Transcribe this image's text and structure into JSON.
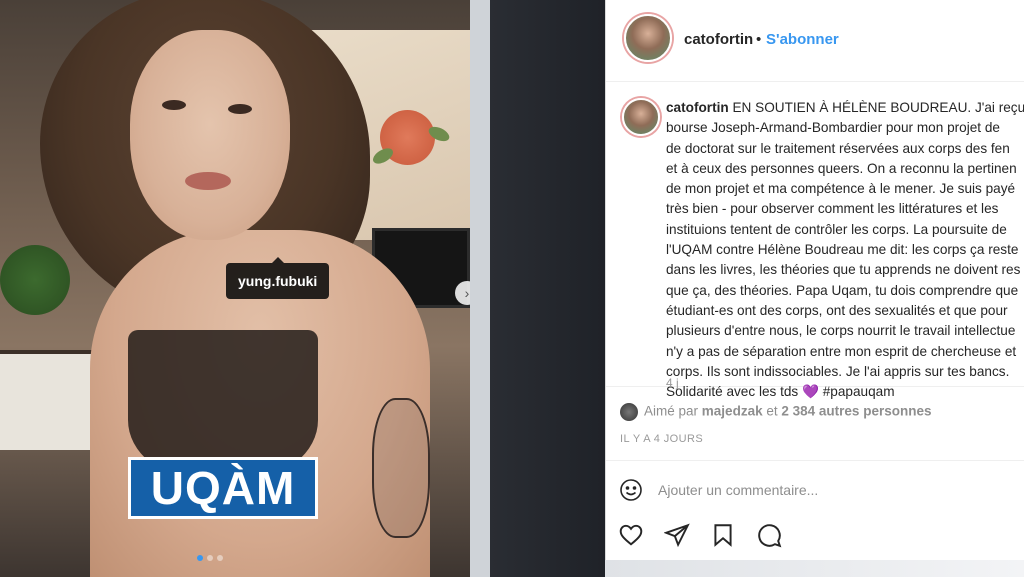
{
  "photo": {
    "usertag": "yung.fubuki",
    "logo_text": "UQÀM",
    "carousel": {
      "total": 3,
      "active": 1
    },
    "next_icon": "chevron-right-icon"
  },
  "header": {
    "username": "catofortin",
    "separator": "•",
    "follow_label": "S'abonner"
  },
  "caption": {
    "username": "catofortin",
    "lines": [
      "EN SOUTIEN À HÉLÈNE BOUDREAU. J'ai reçu",
      "bourse Joseph-Armand-Bombardier pour mon projet de",
      "de doctorat sur le traitement réservées aux corps des fen",
      "et à ceux des personnes queers. On a reconnu la pertinen",
      "de mon projet et ma compétence à le mener. Je suis payé",
      "très bien - pour observer comment les littératures et les",
      "instituions tentent de contrôler les corps. La poursuite de",
      "l'UQAM contre Hélène Boudreau me dit: les corps ça reste",
      "dans les livres, les théories que tu apprends ne doivent res",
      "que ça, des théories. Papa Uqam, tu dois comprendre que",
      "étudiant-es ont des corps, ont des sexualités et que pour",
      "plusieurs d'entre nous, le corps nourrit le travail intellectue",
      "n'y a pas de séparation entre mon esprit de chercheuse et",
      "corps. Ils sont indissociables. Je l'ai appris sur tes bancs.",
      "Solidarité avec les tds 💜 #papauqam"
    ],
    "age": "4 j"
  },
  "likes": {
    "prefix": "Aimé par",
    "user": "majedzak",
    "connector": "et",
    "others": "2 384 autres personnes"
  },
  "date": "IL Y A 4 JOURS",
  "comment": {
    "placeholder": "Ajouter un commentaire...",
    "emoji_icon": "smiley-icon"
  },
  "actions": [
    "heart-icon",
    "send-icon",
    "bookmark-icon",
    "comment-icon"
  ],
  "colors": {
    "link": "#3897f0",
    "uqam_blue": "#1560a8",
    "text": "#262626",
    "muted": "#8e8e8e"
  }
}
